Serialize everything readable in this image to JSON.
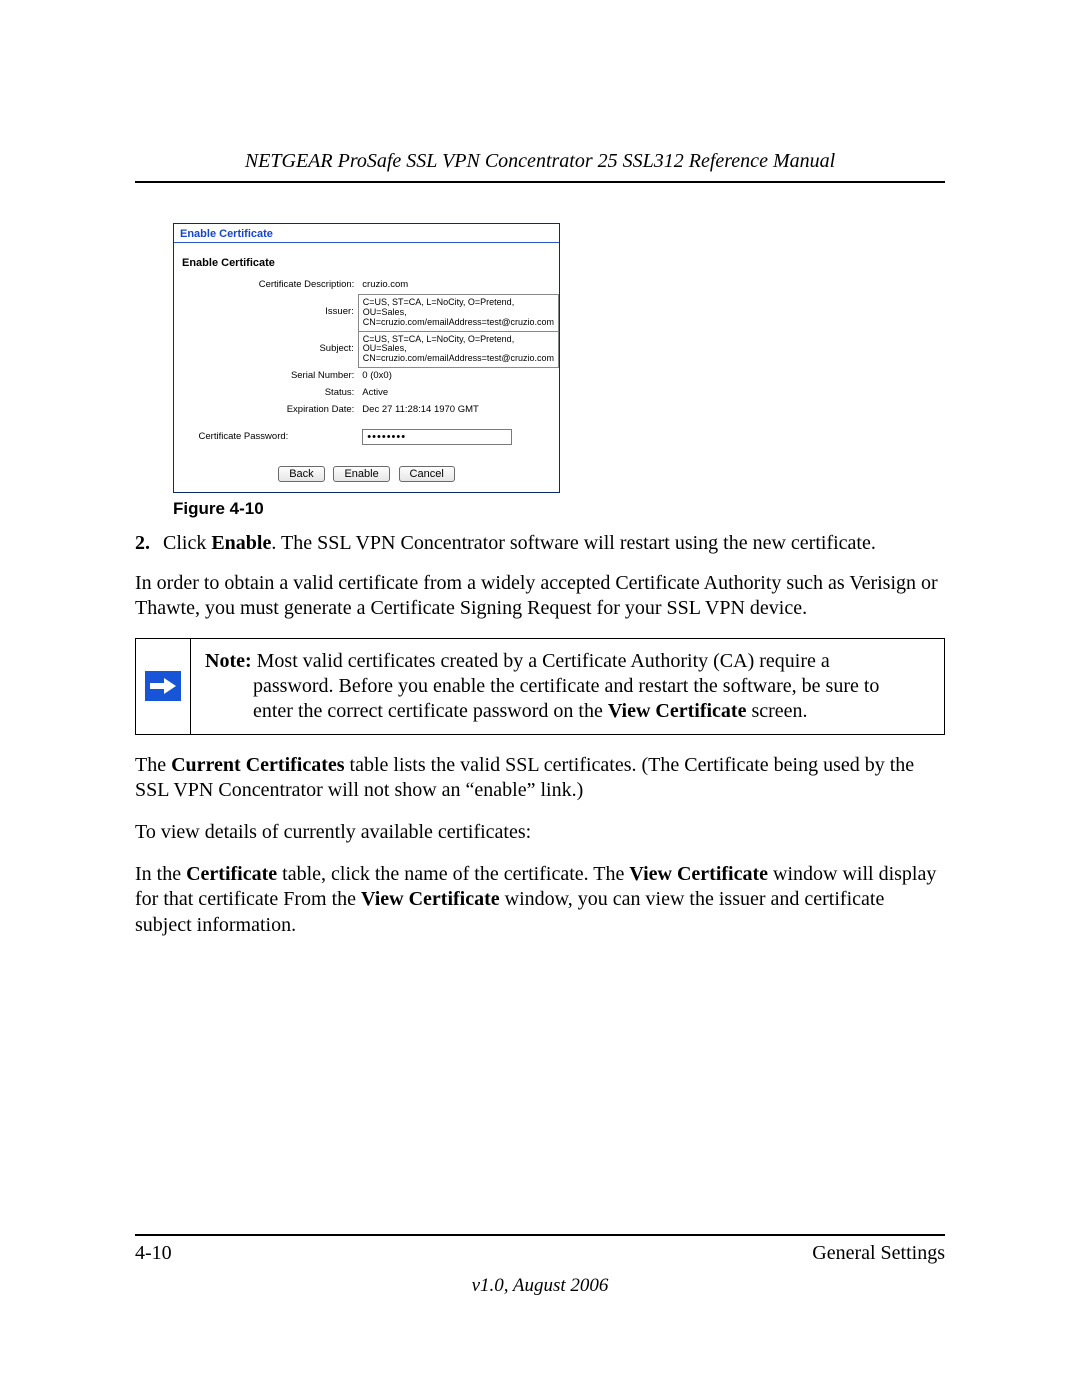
{
  "header": {
    "title": "NETGEAR ProSafe SSL VPN Concentrator 25 SSL312 Reference Manual"
  },
  "screenshot": {
    "panel_title": "Enable Certificate",
    "section_title": "Enable Certificate",
    "rows": {
      "desc_label": "Certificate Description:",
      "desc_value": "cruzio.com",
      "issuer_label": "Issuer:",
      "issuer_value": "C=US, ST=CA, L=NoCity, O=Pretend, OU=Sales, CN=cruzio.com/emailAddress=test@cruzio.com",
      "subject_label": "Subject:",
      "subject_value": "C=US, ST=CA, L=NoCity, O=Pretend, OU=Sales, CN=cruzio.com/emailAddress=test@cruzio.com",
      "serial_label": "Serial Number:",
      "serial_value": "0 (0x0)",
      "status_label": "Status:",
      "status_value": "Active",
      "exp_label": "Expiration Date:",
      "exp_value": "Dec 27 11:28:14 1970 GMT",
      "pw_label": "Certificate Password:",
      "pw_value": "••••••••"
    },
    "buttons": {
      "back": "Back",
      "enable": "Enable",
      "cancel": "Cancel"
    }
  },
  "caption": "Figure 4-10",
  "step2": {
    "num": "2.",
    "pre": "Click ",
    "bold": "Enable",
    "post": ". The SSL VPN Concentrator software will restart using the new certificate."
  },
  "para_ca": "In order to obtain a valid certificate from a widely accepted Certificate Authority such as Verisign or Thawte, you must generate a Certificate Signing Request for your SSL VPN device.",
  "note": {
    "lead": "Note:",
    "line1_rest": " Most valid certificates created by a Certificate Authority (CA) require a",
    "line2": "password. Before you enable the certificate and restart the software, be sure to",
    "line3_pre": "enter the correct certificate password on the ",
    "line3_bold": "View Certificate",
    "line3_post": " screen."
  },
  "para_current": {
    "pre": "The ",
    "b1": "Current Certificates",
    "post": " table lists the valid SSL certificates. (The Certificate being used by the SSL VPN Concentrator will not show an “enable” link.)"
  },
  "para_view": "To view details of currently available certificates:",
  "para_detail": {
    "p1": "In the ",
    "b1": "Certificate",
    "p2": " table, click the name of the certificate. The ",
    "b2": "View Certificate",
    "p3": " window will display for that certificate From the ",
    "b3": "View Certificate",
    "p4": " window, you can view the issuer and certificate subject information."
  },
  "footer": {
    "left": "4-10",
    "right": "General Settings",
    "version": "v1.0, August 2006"
  }
}
